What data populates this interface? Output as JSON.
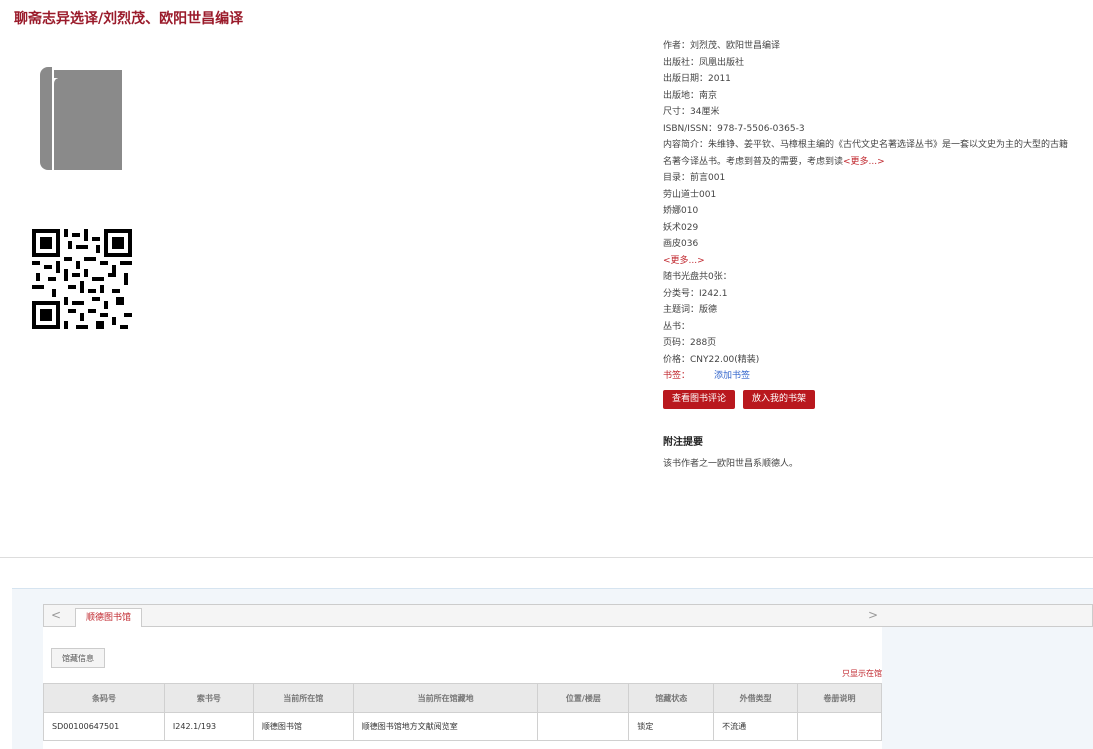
{
  "header": {
    "title": "聊斋志异选译/刘烈茂、欧阳世昌编译"
  },
  "details": {
    "author": "作者：刘烈茂、欧阳世昌编译",
    "publisher": "出版社：凤凰出版社",
    "pub_date": "出版日期：2011",
    "pub_place": "出版地：南京",
    "size": "尺寸：34厘米",
    "isbn": "ISBN/ISSN：978-7-5506-0365-3",
    "summary": "内容简介：朱维铮、姜平钦、马樟根主编的《古代文史名著选译丛书》是一套以文史为主的大型的古籍名著今译丛书。考虑到普及的需要，考虑到读",
    "summary_more": "<更多...>",
    "toc": [
      "目录：前言001",
      "劳山道士001",
      "娇娜010",
      "妖术029",
      "画皮036"
    ],
    "toc_more": "<更多...>",
    "cd": "随书光盘共0张：",
    "class_no": "分类号：I242.1",
    "subject": "主题词：版德",
    "series": "丛书：",
    "pages": "页码：288页",
    "price": "价格：CNY22.00(精装)",
    "bookmark_label": "书签：",
    "bookmark_add": "添加书签",
    "btn_review": "查看图书评论",
    "btn_shelf": "放入我的书架",
    "note_head": "附注提要",
    "note_text": "该书作者之一欧阳世昌系顺德人。"
  },
  "holdings": {
    "tab_prev": "<",
    "tab_next": ">",
    "tab_label": "顺德图书馆",
    "subtab_label": "馆藏信息",
    "only_lib": "只显示在馆",
    "columns": [
      "条码号",
      "索书号",
      "当前所在馆",
      "当前所在馆藏地",
      "位置/楼层",
      "馆藏状态",
      "外借类型",
      "卷册说明"
    ],
    "rows": [
      [
        "SD00100647501",
        "I242.1/193",
        "顺德图书馆",
        "顺德图书馆地方文献阅览室",
        "",
        "锁定",
        "不流通",
        ""
      ]
    ]
  },
  "colors": {
    "accent": "#b9181e",
    "title": "#9a1a2a"
  },
  "icons": [
    "book-icon",
    "qr-code"
  ]
}
